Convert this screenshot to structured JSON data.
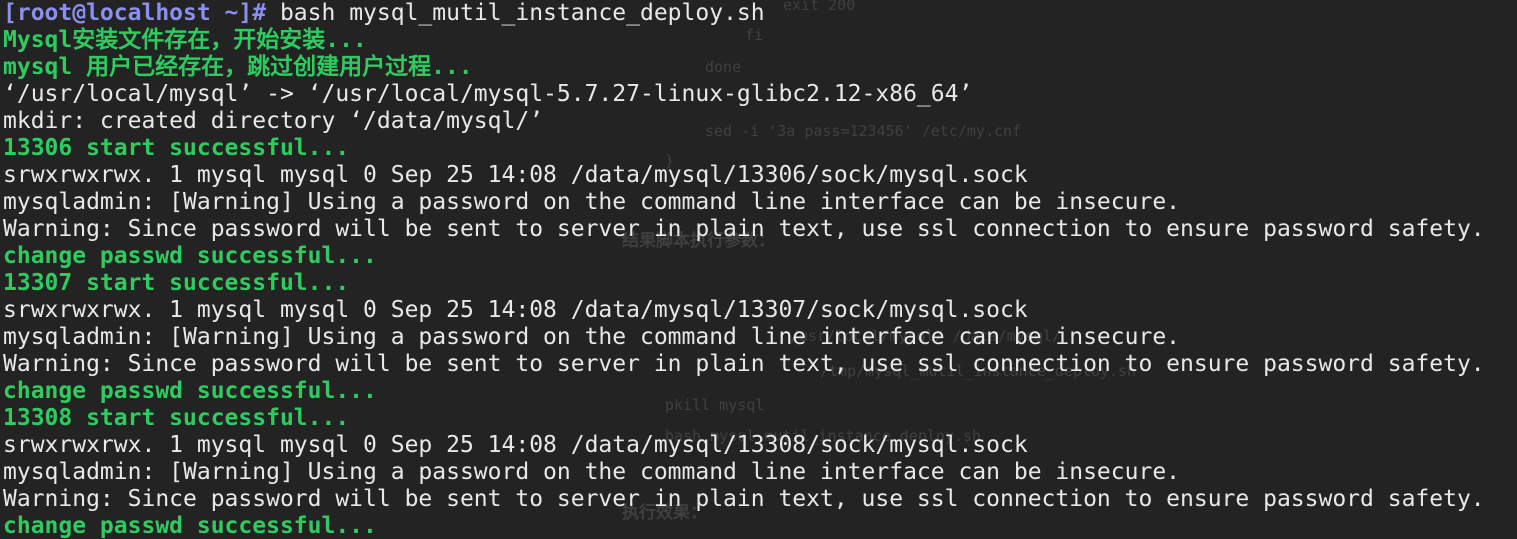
{
  "ghost_text": [
    "exit 200",
    "fi",
    "done",
    "sed -i '3a pass=123456' /etc/my.cnf",
    "}",
    "结果脚本执行参数：",
    "/usr/local/mysql/ /data/mysql/",
    "/tmp/mysql_mutil_instance_deploy.sh",
    "pkill mysql",
    "bash mysql_mutil_instance_deploy.sh",
    "执行效果："
  ],
  "terminal": {
    "prompt": "[root@localhost ~]#",
    "command": " bash mysql_mutil_instance_deploy.sh",
    "lines": [
      "Mysql安装文件存在，开始安装...",
      "mysql 用户已经存在，跳过创建用户过程...",
      "‘/usr/local/mysql’ -> ‘/usr/local/mysql-5.7.27-linux-glibc2.12-x86_64’",
      "mkdir: created directory ‘/data/mysql/’",
      "13306 start successful...",
      "srwxrwxrwx. 1 mysql mysql 0 Sep 25 14:08 /data/mysql/13306/sock/mysql.sock",
      "mysqladmin: [Warning] Using a password on the command line interface can be insecure.",
      "Warning: Since password will be sent to server in plain text, use ssl connection to ensure password safety.",
      "change passwd successful...",
      "13307 start successful...",
      "srwxrwxrwx. 1 mysql mysql 0 Sep 25 14:08 /data/mysql/13307/sock/mysql.sock",
      "mysqladmin: [Warning] Using a password on the command line interface can be insecure.",
      "Warning: Since password will be sent to server in plain text, use ssl connection to ensure password safety.",
      "change passwd successful...",
      "13308 start successful...",
      "srwxrwxrwx. 1 mysql mysql 0 Sep 25 14:08 /data/mysql/13308/sock/mysql.sock",
      "mysqladmin: [Warning] Using a password on the command line interface can be insecure.",
      "Warning: Since password will be sent to server in plain text, use ssl connection to ensure password safety.",
      "change passwd successful..."
    ]
  },
  "colors": {
    "background": "#232323",
    "text": "#e8e8e8",
    "success": "#2ecc5f",
    "prompt": "#8b8ff2"
  }
}
